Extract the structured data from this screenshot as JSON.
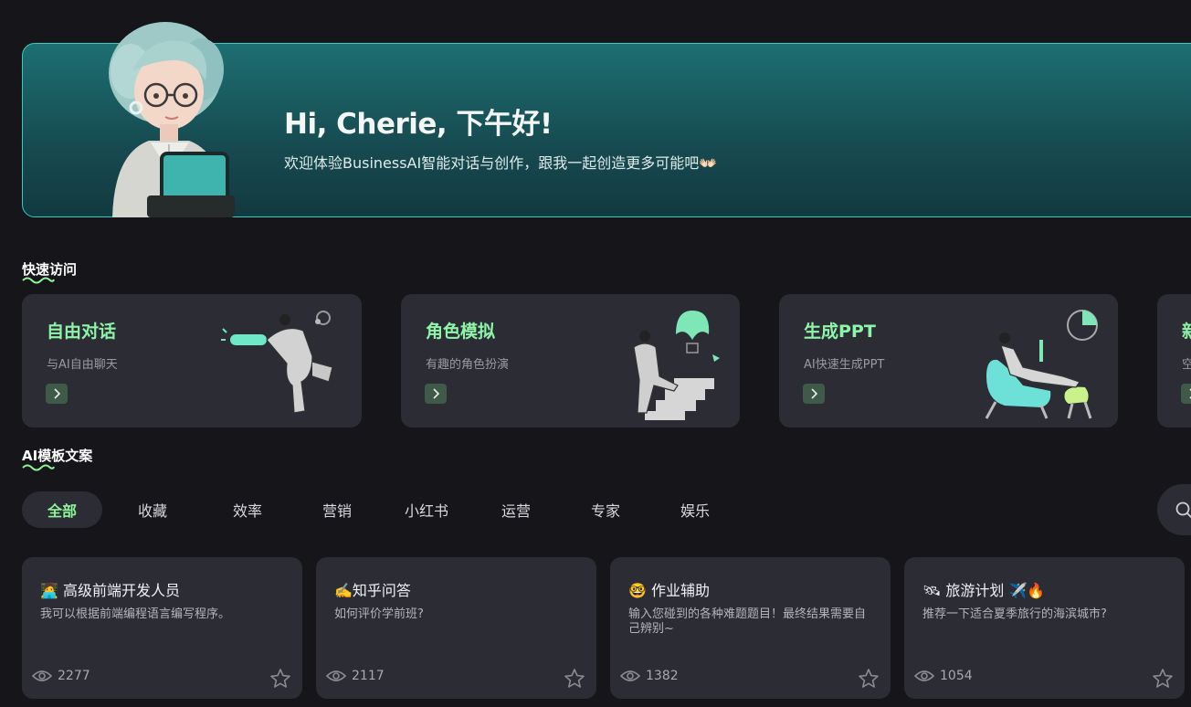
{
  "banner": {
    "greeting": "Hi, Cherie, 下午好!",
    "subtitle": "欢迎体验BusinessAI智能对话与创作，跟我一起创造更多可能吧👐🏻"
  },
  "quick_access": {
    "title": "快速访问",
    "cards": [
      {
        "title": "自由对话",
        "desc": "与AI自由聊天",
        "title_color": "#7ef0a0",
        "icon": "chevron-right-icon"
      },
      {
        "title": "角色模拟",
        "desc": "有趣的角色扮演",
        "title_color": "#7ef0a0",
        "icon": "chevron-right-icon"
      },
      {
        "title": "生成PPT",
        "desc": "AI快速生成PPT",
        "title_color": "#7ef0a0",
        "icon": "chevron-right-icon"
      },
      {
        "title": "新",
        "desc": "空",
        "title_color": "#7ef0a0",
        "icon": "chevron-right-icon"
      }
    ]
  },
  "templates": {
    "title": "AI模板文案",
    "tabs": [
      "全部",
      "收藏",
      "效率",
      "营销",
      "小红书",
      "运营",
      "专家",
      "娱乐"
    ],
    "active_tab": "全部",
    "cards": [
      {
        "title": "🧑‍💻 高级前端开发人员",
        "desc": "我可以根据前端编程语言编写程序。",
        "views": "2277"
      },
      {
        "title": "✍️知乎问答",
        "desc": "如何评价学前班?",
        "views": "2117"
      },
      {
        "title": "🤓 作业辅助",
        "desc": "输入您碰到的各种难题题目！最终结果需要自己辨别~",
        "views": "1382"
      },
      {
        "title": "🛰 旅游计划 ✈️🔥",
        "desc": "推荐一下适合夏季旅行的海滨城市?",
        "views": "1054"
      }
    ]
  },
  "colors": {
    "accent_green": "#8ef59a",
    "banner_border": "#2ecfc4",
    "card_bg": "#2c2c35",
    "page_bg": "#15151a"
  }
}
